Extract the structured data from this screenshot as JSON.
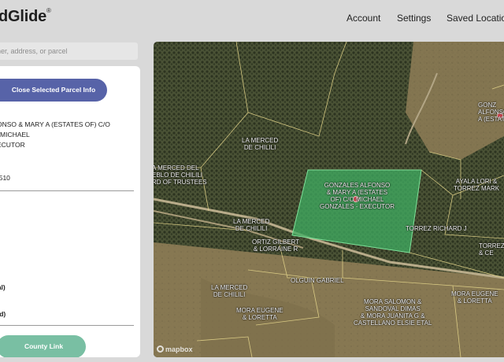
{
  "header": {
    "logo_text": "dGlide",
    "logo_mark": "®",
    "nav": {
      "account": "Account",
      "settings": "Settings",
      "saved": "Saved Locations"
    }
  },
  "search": {
    "placeholder": "ner, address, or parcel"
  },
  "panel": {
    "close_button": "Close Selected Parcel Info",
    "owner_line1": "ONSO & MARY A (ESTATES OF) C/O MICHAEL",
    "owner_line2": "ECUTOR",
    "parcel": "0510",
    "total_label": "tal)",
    "land_label": "nd)",
    "county_button": "County Link"
  },
  "map": {
    "attribution": "mapbox",
    "labels": [
      "LA MERCED\nDE CHILILI",
      "A MERCED DEL\nEBLO DE CHILILI\nRD OF TRUSTEES",
      "LA MERCED\nDE CHILILI",
      "GONZALES ALFONSO\n& MARY A (ESTATES\nOF) C/O MICHAEL\nGONZALES - EXECUTOR",
      "GONZ\nALFONSO &\nA (ESTATE",
      "AYALA LORI &\nTORREZ MARK",
      "TORREZ RICHARD J",
      "TORREZ\n& CE",
      "ORTIZ GILBERT\n& LORRAINE R",
      "OLGUIN GABRIEL",
      "LA MERCED\nDE CHILILI",
      "MORA EUGENE\n& LORETTA",
      "MORA SALOMON &\nSANDOVAL DIMAS\n& MORA JUANITA G &\nCASTELLANO ELSIE ETAL",
      "MORA EUGENE\n& LORETTA"
    ]
  },
  "colors": {
    "accent": "#5763a8",
    "county": "#79bfa3",
    "selected_parcel": "#3fae62"
  }
}
